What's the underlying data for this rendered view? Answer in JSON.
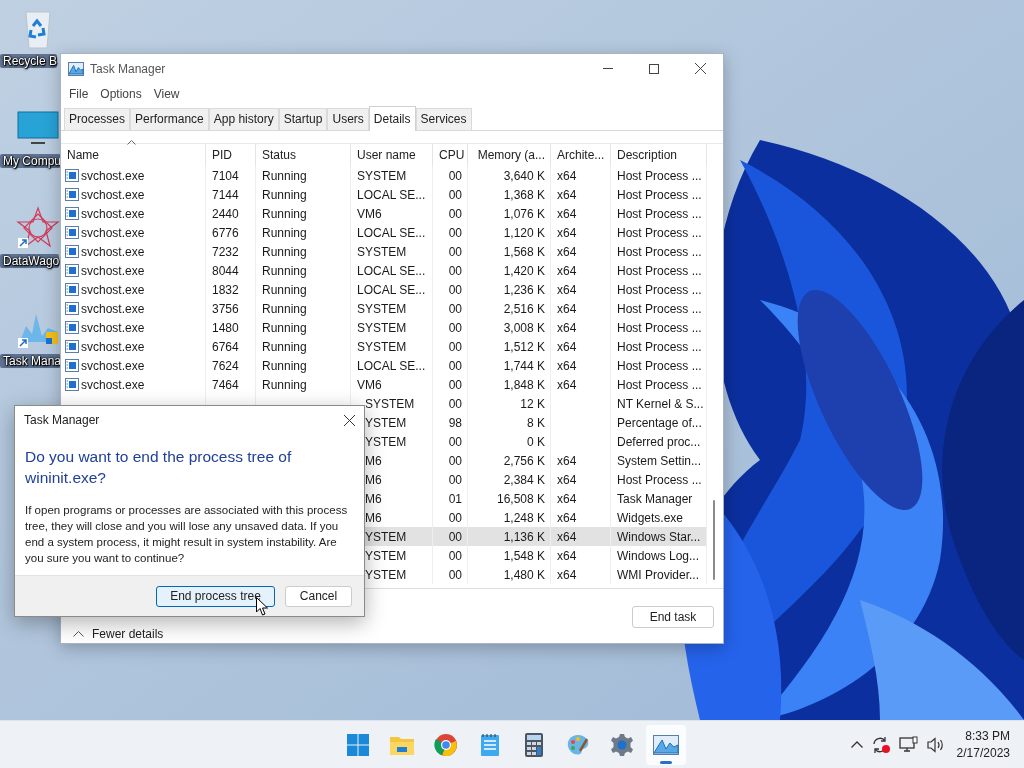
{
  "desktop_icons": [
    {
      "kind": "recycle",
      "label": "Recycle B"
    },
    {
      "kind": "computer",
      "label": "My Compu"
    },
    {
      "kind": "star",
      "label": "DataWago"
    },
    {
      "kind": "chart",
      "label": "Task Mana"
    }
  ],
  "window": {
    "title": "Task Manager",
    "menu": [
      "File",
      "Options",
      "View"
    ],
    "tabs": [
      {
        "label": "Processes",
        "selected": false
      },
      {
        "label": "Performance",
        "selected": false
      },
      {
        "label": "App history",
        "selected": false
      },
      {
        "label": "Startup",
        "selected": false
      },
      {
        "label": "Users",
        "selected": false
      },
      {
        "label": "Details",
        "selected": true
      },
      {
        "label": "Services",
        "selected": false
      }
    ],
    "columns": [
      {
        "label": "Name",
        "sorted": true
      },
      {
        "label": "PID",
        "sorted": false
      },
      {
        "label": "Status",
        "sorted": false
      },
      {
        "label": "User name",
        "sorted": false
      },
      {
        "label": "CPU",
        "sorted": false
      },
      {
        "label": "Memory (a...",
        "sorted": false
      },
      {
        "label": "Archite...",
        "sorted": false
      },
      {
        "label": "Description",
        "sorted": false
      }
    ],
    "rows": [
      {
        "name": "svchost.exe",
        "pid": "7104",
        "status": "Running",
        "user": "SYSTEM",
        "cpu": "00",
        "memory": "3,640 K",
        "arch": "x64",
        "description": "Host Process ...",
        "selected": false
      },
      {
        "name": "svchost.exe",
        "pid": "7144",
        "status": "Running",
        "user": "LOCAL SE...",
        "cpu": "00",
        "memory": "1,368 K",
        "arch": "x64",
        "description": "Host Process ...",
        "selected": false
      },
      {
        "name": "svchost.exe",
        "pid": "2440",
        "status": "Running",
        "user": "VM6",
        "cpu": "00",
        "memory": "1,076 K",
        "arch": "x64",
        "description": "Host Process ...",
        "selected": false
      },
      {
        "name": "svchost.exe",
        "pid": "6776",
        "status": "Running",
        "user": "LOCAL SE...",
        "cpu": "00",
        "memory": "1,120 K",
        "arch": "x64",
        "description": "Host Process ...",
        "selected": false
      },
      {
        "name": "svchost.exe",
        "pid": "7232",
        "status": "Running",
        "user": "SYSTEM",
        "cpu": "00",
        "memory": "1,568 K",
        "arch": "x64",
        "description": "Host Process ...",
        "selected": false
      },
      {
        "name": "svchost.exe",
        "pid": "8044",
        "status": "Running",
        "user": "LOCAL SE...",
        "cpu": "00",
        "memory": "1,420 K",
        "arch": "x64",
        "description": "Host Process ...",
        "selected": false
      },
      {
        "name": "svchost.exe",
        "pid": "1832",
        "status": "Running",
        "user": "LOCAL SE...",
        "cpu": "00",
        "memory": "1,236 K",
        "arch": "x64",
        "description": "Host Process ...",
        "selected": false
      },
      {
        "name": "svchost.exe",
        "pid": "3756",
        "status": "Running",
        "user": "SYSTEM",
        "cpu": "00",
        "memory": "2,516 K",
        "arch": "x64",
        "description": "Host Process ...",
        "selected": false
      },
      {
        "name": "svchost.exe",
        "pid": "1480",
        "status": "Running",
        "user": "SYSTEM",
        "cpu": "00",
        "memory": "3,008 K",
        "arch": "x64",
        "description": "Host Process ...",
        "selected": false
      },
      {
        "name": "svchost.exe",
        "pid": "6764",
        "status": "Running",
        "user": "SYSTEM",
        "cpu": "00",
        "memory": "1,512 K",
        "arch": "x64",
        "description": "Host Process ...",
        "selected": false
      },
      {
        "name": "svchost.exe",
        "pid": "7624",
        "status": "Running",
        "user": "LOCAL SE...",
        "cpu": "00",
        "memory": "1,744 K",
        "arch": "x64",
        "description": "Host Process ...",
        "selected": false
      },
      {
        "name": "svchost.exe",
        "pid": "7464",
        "status": "Running",
        "user": "VM6",
        "cpu": "00",
        "memory": "1,848 K",
        "arch": "x64",
        "description": "Host Process ...",
        "selected": false
      },
      {
        "user": "SYSTEM",
        "cpu": "00",
        "memory": "12 K",
        "description": "NT Kernel & S...",
        "selected": false
      },
      {
        "user": "YSTEM",
        "cpu": "98",
        "memory": "8 K",
        "description": "Percentage of...",
        "selected": false
      },
      {
        "user": "YSTEM",
        "cpu": "00",
        "memory": "0 K",
        "description": "Deferred proc...",
        "selected": false
      },
      {
        "user": "M6",
        "cpu": "00",
        "memory": "2,756 K",
        "arch": "x64",
        "description": "System Settin...",
        "selected": false
      },
      {
        "user": "M6",
        "cpu": "00",
        "memory": "2,384 K",
        "arch": "x64",
        "description": "Host Process ...",
        "selected": false
      },
      {
        "user": "M6",
        "cpu": "01",
        "memory": "16,508 K",
        "arch": "x64",
        "description": "Task Manager",
        "selected": false
      },
      {
        "user": "M6",
        "cpu": "00",
        "memory": "1,248 K",
        "arch": "x64",
        "description": "Widgets.exe",
        "selected": false
      },
      {
        "user": "YSTEM",
        "cpu": "00",
        "memory": "1,136 K",
        "arch": "x64",
        "description": "Windows Star...",
        "selected": true
      },
      {
        "user": "YSTEM",
        "cpu": "00",
        "memory": "1,548 K",
        "arch": "x64",
        "description": "Windows Log...",
        "selected": false
      },
      {
        "user": "YSTEM",
        "cpu": "00",
        "memory": "1,480 K",
        "arch": "x64",
        "description": "WMI Provider...",
        "selected": false
      }
    ],
    "footer": {
      "toggle": "Fewer details",
      "button": "End task"
    }
  },
  "dialog": {
    "title": "Task Manager",
    "heading": "Do you want to end the process tree of wininit.exe?",
    "message": "If open programs or processes are associated with this process tree, they will close and you will lose any unsaved data. If you end a system process, it might result in system instability. Are you sure you want to continue?",
    "buttons": [
      {
        "label": "End process tree",
        "kind": "primary"
      },
      {
        "label": "Cancel",
        "kind": "secondary"
      }
    ]
  },
  "taskbar": {
    "apps": [
      {
        "kind": "start",
        "selected": false
      },
      {
        "kind": "folder",
        "selected": false
      },
      {
        "kind": "browser",
        "selected": false
      },
      {
        "kind": "notepad",
        "selected": false
      },
      {
        "kind": "calculator",
        "selected": false
      },
      {
        "kind": "paint",
        "selected": false
      },
      {
        "kind": "settings",
        "selected": false
      },
      {
        "kind": "chart",
        "selected": true
      }
    ],
    "time": "8:33 PM",
    "date": "2/17/2023"
  }
}
